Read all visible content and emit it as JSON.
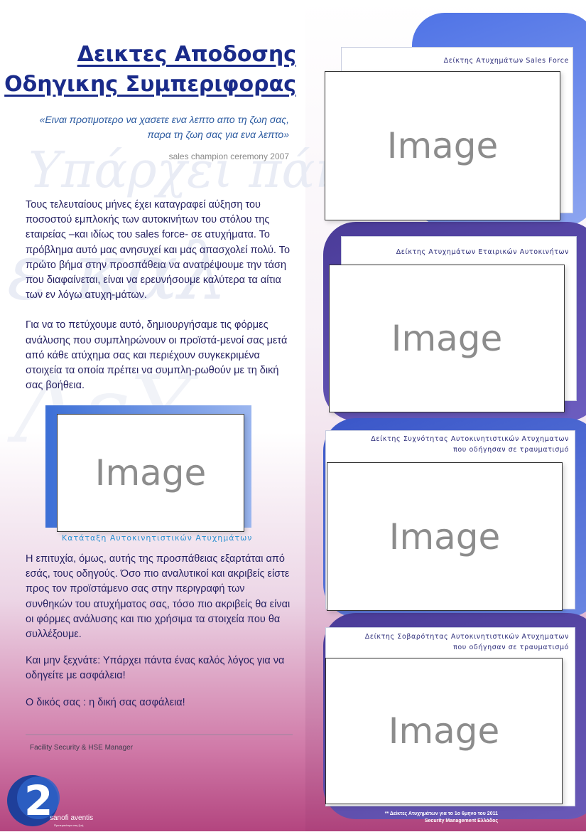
{
  "title": {
    "line1": "Δεικτες Αποδοσης",
    "line2": "Οδηγικης Συμπεριφορας"
  },
  "quote": {
    "line1": "«Ειναι προτιμοτερο να χασετε ενα λεπτο απο τη ζωη σας,",
    "line2": "παρα τη ζωη σας για ενα λεπτο»",
    "source": "sales champion ceremony 2007"
  },
  "watermark": {
    "line1": "Υπάρχει πάν",
    "line2": "ε καλ",
    "line3": "ΛεΥ"
  },
  "paragraphs": {
    "p1": " Τους τελευταίους μήνες έχει καταγραφεί αύξηση του ποσοστού εμπλοκής των αυτοκινήτων του στόλου της εταιρείας –και ιδίως του sales force- σε ατυχήματα. Το πρόβλημα αυτό μας ανησυχεί και μας απασχολεί πολύ. Το πρώτο βήμα στην προσπάθεια να ανατρέψουμε την τάση που διαφαίνεται, είναι να ερευνήσουμε καλύτερα τα αίτια των εν λόγω ατυχη-μάτων.",
    "p2": " Για να το πετύχουμε αυτό, δημιουργήσαμε τις φόρμες ανάλυσης που συμπληρώνουν οι προϊστά-μενοί σας μετά από κάθε ατύχημα σας και περιέχουν συγκεκριμένα στοιχεία τα οποία πρέπει να συμπλη-ρωθούν με τη δική σας βοήθεια.",
    "p3": " Η επιτυχία, όμως, αυτής της προσπάθειας εξαρτάται από εσάς, τους οδηγούς. Όσο πιο αναλυτικοί και ακριβείς είστε προς τον προϊστάμενο σας στην περιγραφή των συνθηκών του ατυχήματος σας, τόσο πιο ακριβείς θα είναι οι φόρμες ανάλυσης και πιο χρήσιμα τα στοιχεία που θα συλλέξουμε.",
    "p4": "Και μην ξεχνάτε: Υπάρχει πάντα ένας καλός λόγος για να οδηγείτε με ασφάλεια!",
    "p5": "Ο δικός σας : η δική σας ασφάλεια!"
  },
  "image_placeholder_label": "Image",
  "left_chart_caption": "Κατάταξη Αυτοκινητιστικών Ατυχημάτων",
  "charts": {
    "c1": {
      "title": "Δείκτης Ατυχημάτων Sales Force"
    },
    "c2": {
      "title": "Δείκτης Ατυχημάτων Εταιρικών Αυτοκινήτων"
    },
    "c3": {
      "title_line1": "Δείκτης Συχνότητας Αυτοκινητιστικών Ατυχηματων",
      "title_line2": "που οδήγησαν σε τραυματισμό"
    },
    "c4": {
      "title_line1": "Δείκτης Σοβαρότητας Αυτοκινητιστικών Ατυχηματων",
      "title_line2": "που οδήγησαν σε τραυματισμό"
    }
  },
  "signature": "Facility Security & HSE Manager",
  "footnote": {
    "line1": "** Δείκτες Ατυχημάτων για το 1ο 6μηνο του 2011",
    "line2": "Security Management Ελλάδος"
  },
  "logo": {
    "number": "2",
    "brand": "sanofi aventis",
    "tagline": "Προτεραιότητα στη ζωή"
  },
  "colors": {
    "title": "#1a2b8a",
    "accent_blue": "#4a6fd8",
    "accent_purple": "#5b4aa8",
    "bottom_magenta": "#b3457f"
  }
}
